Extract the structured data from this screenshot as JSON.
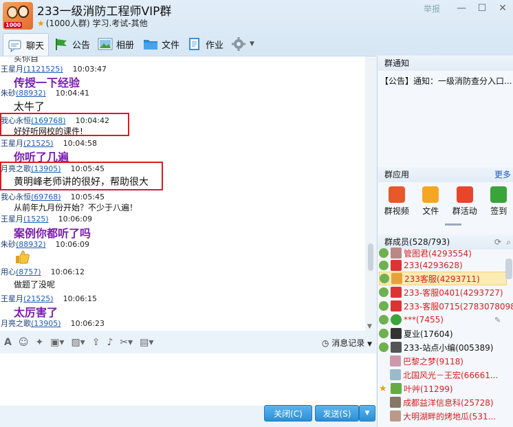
{
  "header": {
    "title": "233一级消防工程师VIP群",
    "subtitle": "(1000人群) 学习.考试-其他",
    "avatar_tag": "1000",
    "report": "举报"
  },
  "tabs": [
    {
      "label": "聊天",
      "icon": "chat-icon"
    },
    {
      "label": "公告",
      "icon": "flag-icon"
    },
    {
      "label": "相册",
      "icon": "photo-icon"
    },
    {
      "label": "文件",
      "icon": "folder-icon"
    },
    {
      "label": "作业",
      "icon": "homework-icon"
    }
  ],
  "chat": {
    "cut_text": "买你自",
    "messages": [
      {
        "name": "王星月",
        "qq": "(1121525)",
        "time": "10:03:47",
        "text": "传授一下经验",
        "style": "purple"
      },
      {
        "name": "朱砂",
        "qq": "(88932)",
        "time": "10:04:41",
        "text": "太牛了",
        "style": "black"
      },
      {
        "name": "我心永恒",
        "qq": "(169768)",
        "time": "10:04:42",
        "text": "好好听网校的课件!",
        "style": "small"
      },
      {
        "name": "王星月",
        "qq": "(21525)",
        "time": "10:04:58",
        "text": "你听了几遍",
        "style": "purple"
      },
      {
        "name": "月亮之歌",
        "qq": "(13905)",
        "time": "10:05:45",
        "text": "黄明峰老师讲的很好，帮助很大",
        "style": "black"
      },
      {
        "name": "我心永恒",
        "qq": "(69768)",
        "time": "10:05:45",
        "text": "从前年九月份开始？不少于八遍！",
        "style": "small"
      },
      {
        "name": "王星月",
        "qq": "(1525)",
        "time": "10:06:09",
        "text": "案例你都听了吗",
        "style": "purple"
      },
      {
        "name": "朱砂",
        "qq": "(88932)",
        "time": "10:06:09",
        "text": "",
        "style": "thumb"
      },
      {
        "name": "用心",
        "qq": "(8757)",
        "time": "10:06:12",
        "text": "做题了没呢",
        "style": "small"
      },
      {
        "name": "王星月",
        "qq": "(21525)",
        "time": "10:06:15",
        "text": "太厉害了",
        "style": "purple"
      },
      {
        "name": "月亮之歌",
        "qq": "(13905)",
        "time": "10:06:23",
        "text": "",
        "style": "none"
      }
    ]
  },
  "input_toolbar": {
    "record_label": "消息记录"
  },
  "buttons": {
    "close": "关闭(C)",
    "send": "发送(S)"
  },
  "right": {
    "notice_title": "群通知",
    "notice_text": "【公告】通知：一级消防查分入口...",
    "apps_title": "群应用",
    "apps_more": "更多",
    "apps": [
      {
        "label": "群视频",
        "color": "#e8582b"
      },
      {
        "label": "文件",
        "color": "#f5a623"
      },
      {
        "label": "群活动",
        "color": "#e8452b"
      },
      {
        "label": "签到",
        "color": "#3aa43a"
      }
    ],
    "members_title": "群成员(528/793)",
    "members": [
      {
        "text": "管图君(4293554)",
        "color": "#d81e1e"
      },
      {
        "text": "233(4293628)",
        "color": "#d81e1e"
      },
      {
        "text": "233客服(4293711)",
        "color": "#d81e1e"
      },
      {
        "text": "233-客服0401(4293727)",
        "color": "#d81e1e"
      },
      {
        "text": "233-客服0715(2783078098)",
        "color": "#d81e1e"
      },
      {
        "text": "***(7455)",
        "color": "#d81e1e"
      },
      {
        "text": "夏业(17604)",
        "color": "#111"
      },
      {
        "text": "233-站点小编(005389)",
        "color": "#111"
      },
      {
        "text": "巴黎之梦(9118)",
        "color": "#d81e1e"
      },
      {
        "text": "北国风光－王宏(66661...",
        "color": "#d81e1e"
      },
      {
        "text": "叶艸(11299)",
        "color": "#d81e1e"
      },
      {
        "text": "成都益洋信息科(25728)",
        "color": "#d81e1e"
      },
      {
        "text": "大明湖畔的烤地瓜(531...",
        "color": "#d81e1e"
      }
    ]
  }
}
